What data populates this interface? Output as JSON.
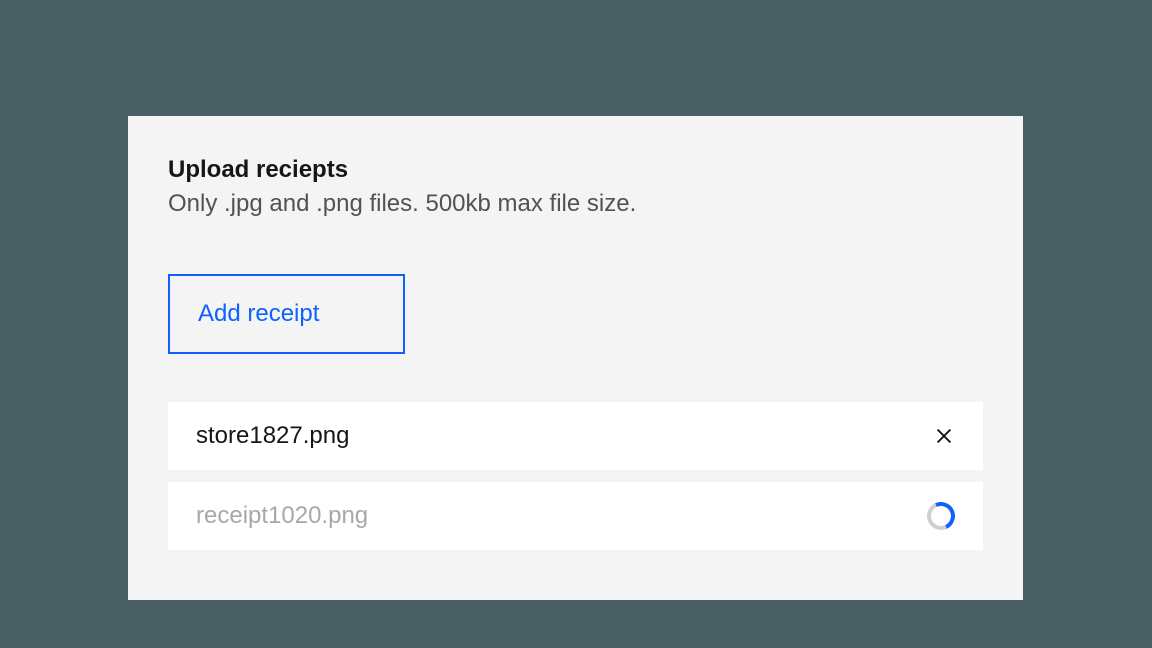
{
  "upload": {
    "title": "Upload reciepts",
    "description": "Only .jpg and .png files. 500kb max file size.",
    "button_label": "Add receipt",
    "files": [
      {
        "name": "store1827.png",
        "status": "done"
      },
      {
        "name": "receipt1020.png",
        "status": "loading"
      }
    ]
  }
}
